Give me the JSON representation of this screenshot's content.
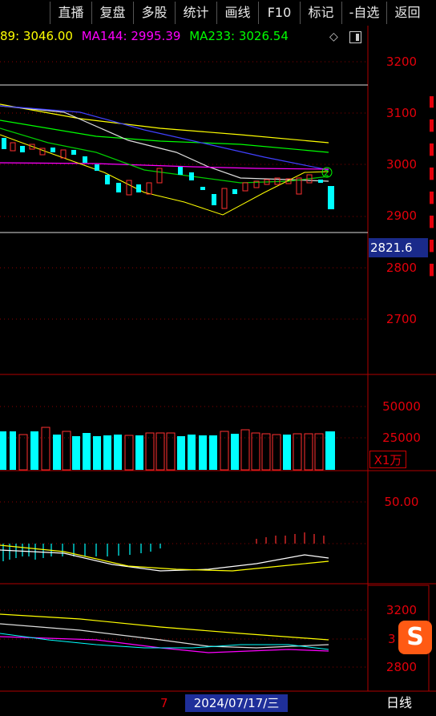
{
  "toolbar": {
    "items": [
      "直播",
      "复盘",
      "多股",
      "统计",
      "画线",
      "F10",
      "标记",
      "-自选",
      "返回"
    ]
  },
  "ma": {
    "ma89": "89: 3046.00",
    "ma144": "MA144: 2995.39",
    "ma233": "MA233: 3026.54"
  },
  "price_axis": [
    "3200",
    "3100",
    "3000",
    "2900",
    "2800",
    "2700"
  ],
  "current_price": "2821.6",
  "volume_axis": [
    "50000",
    "25000"
  ],
  "volume_unit": "X1万",
  "macd_axis": [
    "50.00"
  ],
  "sub_axis": [
    "3200",
    "3",
    "2800"
  ],
  "date_left": "7",
  "date": "2024/07/17/三",
  "period": "日线",
  "marker": "2",
  "colors": {
    "up": "#ff3030",
    "down": "#00ffff",
    "grid": "#b00000",
    "ma89": "#ffff00",
    "ma144": "#ff00ff",
    "ma233": "#00ff00"
  }
}
